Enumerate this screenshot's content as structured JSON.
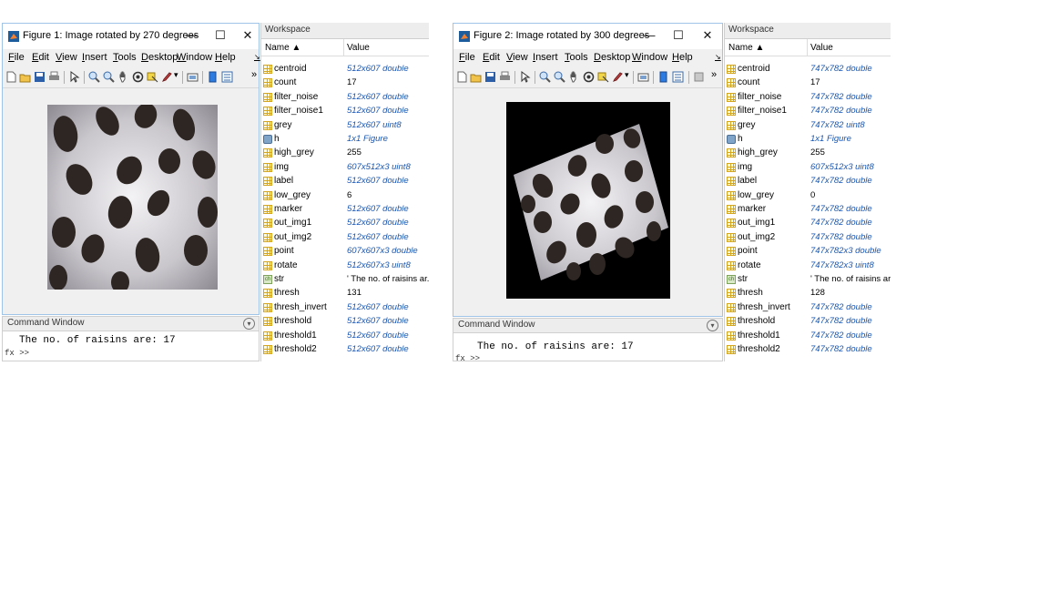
{
  "figures": [
    {
      "title": "Figure 1: Image rotated by 270 degrees",
      "menu": [
        "File",
        "Edit",
        "View",
        "Insert",
        "Tools",
        "Desktop",
        "Window",
        "Help"
      ],
      "command_title": "Command Window",
      "command_output": "The no. of raisins are: 17",
      "prompt": "fx >>",
      "workspace": {
        "title": "Workspace",
        "col_name": "Name ▲",
        "col_value": "Value",
        "vars": [
          {
            "name": "centroid",
            "value": "512x607 double",
            "icon": "grid",
            "kind": "array"
          },
          {
            "name": "count",
            "value": "17",
            "icon": "grid",
            "kind": "scalar"
          },
          {
            "name": "filter_noise",
            "value": "512x607 double",
            "icon": "grid",
            "kind": "array"
          },
          {
            "name": "filter_noise1",
            "value": "512x607 double",
            "icon": "grid",
            "kind": "array"
          },
          {
            "name": "grey",
            "value": "512x607 uint8",
            "icon": "grid",
            "kind": "array"
          },
          {
            "name": "h",
            "value": "1x1 Figure",
            "icon": "fig",
            "kind": "array"
          },
          {
            "name": "high_grey",
            "value": "255",
            "icon": "grid",
            "kind": "scalar"
          },
          {
            "name": "img",
            "value": "607x512x3 uint8",
            "icon": "grid",
            "kind": "array"
          },
          {
            "name": "label",
            "value": "512x607 double",
            "icon": "grid",
            "kind": "array"
          },
          {
            "name": "low_grey",
            "value": "6",
            "icon": "grid",
            "kind": "scalar"
          },
          {
            "name": "marker",
            "value": "512x607 double",
            "icon": "grid",
            "kind": "array"
          },
          {
            "name": "out_img1",
            "value": "512x607 double",
            "icon": "grid",
            "kind": "array"
          },
          {
            "name": "out_img2",
            "value": "512x607 double",
            "icon": "grid",
            "kind": "array"
          },
          {
            "name": "point",
            "value": "607x607x3 double",
            "icon": "grid",
            "kind": "array"
          },
          {
            "name": "rotate",
            "value": "512x607x3 uint8",
            "icon": "grid",
            "kind": "array"
          },
          {
            "name": "str",
            "value": "' The no. of raisins ar...",
            "icon": "str",
            "kind": "scalar"
          },
          {
            "name": "thresh",
            "value": "131",
            "icon": "grid",
            "kind": "scalar"
          },
          {
            "name": "thresh_invert",
            "value": "512x607 double",
            "icon": "grid",
            "kind": "array"
          },
          {
            "name": "threshold",
            "value": "512x607 double",
            "icon": "grid",
            "kind": "array"
          },
          {
            "name": "threshold1",
            "value": "512x607 double",
            "icon": "grid",
            "kind": "array"
          },
          {
            "name": "threshold2",
            "value": "512x607 double",
            "icon": "grid",
            "kind": "array"
          }
        ]
      }
    },
    {
      "title": "Figure 2: Image rotated by 300 degrees",
      "menu": [
        "File",
        "Edit",
        "View",
        "Insert",
        "Tools",
        "Desktop",
        "Window",
        "Help"
      ],
      "command_title": "Command Window",
      "command_output": "The no. of raisins are: 17",
      "prompt": "fx >>",
      "workspace": {
        "title": "Workspace",
        "col_name": "Name ▲",
        "col_value": "Value",
        "vars": [
          {
            "name": "centroid",
            "value": "747x782 double",
            "icon": "grid",
            "kind": "array"
          },
          {
            "name": "count",
            "value": "17",
            "icon": "grid",
            "kind": "scalar"
          },
          {
            "name": "filter_noise",
            "value": "747x782 double",
            "icon": "grid",
            "kind": "array"
          },
          {
            "name": "filter_noise1",
            "value": "747x782 double",
            "icon": "grid",
            "kind": "array"
          },
          {
            "name": "grey",
            "value": "747x782 uint8",
            "icon": "grid",
            "kind": "array"
          },
          {
            "name": "h",
            "value": "1x1 Figure",
            "icon": "fig",
            "kind": "array"
          },
          {
            "name": "high_grey",
            "value": "255",
            "icon": "grid",
            "kind": "scalar"
          },
          {
            "name": "img",
            "value": "607x512x3 uint8",
            "icon": "grid",
            "kind": "array"
          },
          {
            "name": "label",
            "value": "747x782 double",
            "icon": "grid",
            "kind": "array"
          },
          {
            "name": "low_grey",
            "value": "0",
            "icon": "grid",
            "kind": "scalar"
          },
          {
            "name": "marker",
            "value": "747x782 double",
            "icon": "grid",
            "kind": "array"
          },
          {
            "name": "out_img1",
            "value": "747x782 double",
            "icon": "grid",
            "kind": "array"
          },
          {
            "name": "out_img2",
            "value": "747x782 double",
            "icon": "grid",
            "kind": "array"
          },
          {
            "name": "point",
            "value": "747x782x3 double",
            "icon": "grid",
            "kind": "array"
          },
          {
            "name": "rotate",
            "value": "747x782x3 uint8",
            "icon": "grid",
            "kind": "array"
          },
          {
            "name": "str",
            "value": "' The no. of raisins ar...",
            "icon": "str",
            "kind": "scalar"
          },
          {
            "name": "thresh",
            "value": "128",
            "icon": "grid",
            "kind": "scalar"
          },
          {
            "name": "thresh_invert",
            "value": "747x782 double",
            "icon": "grid",
            "kind": "array"
          },
          {
            "name": "threshold",
            "value": "747x782 double",
            "icon": "grid",
            "kind": "array"
          },
          {
            "name": "threshold1",
            "value": "747x782 double",
            "icon": "grid",
            "kind": "array"
          },
          {
            "name": "threshold2",
            "value": "747x782 double",
            "icon": "grid",
            "kind": "array"
          }
        ]
      }
    }
  ],
  "colors": {
    "value_blue": "#1a56b0",
    "window_border": "#a0c4e8",
    "photo_bg": "#000000"
  }
}
